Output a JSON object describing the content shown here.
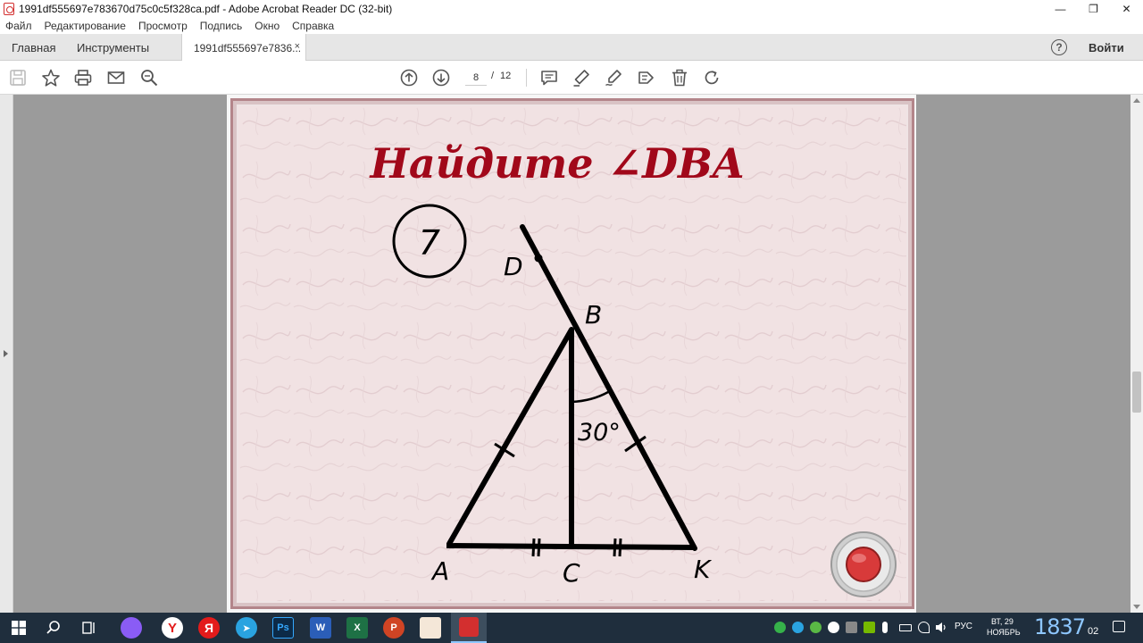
{
  "window": {
    "title": "1991df555697e783670d75c0c5f328ca.pdf - Adobe Acrobat Reader DC (32-bit)",
    "minimize": "—",
    "maximize": "❐",
    "close": "✕"
  },
  "menu": [
    "Файл",
    "Редактирование",
    "Просмотр",
    "Подпись",
    "Окно",
    "Справка"
  ],
  "tabs": {
    "home": "Главная",
    "tools": "Инструменты",
    "document": "1991df555697e7836...",
    "close": "×",
    "help": "?",
    "signin": "Войти"
  },
  "toolbar": {
    "current_page": "8",
    "separator": "/",
    "total_pages": "12"
  },
  "slide": {
    "title": "Найдите  ∠DBA",
    "problem_number": "7",
    "angle_label": "30°",
    "points": {
      "D": "D",
      "B": "B",
      "A": "A",
      "C": "C",
      "K": "K"
    }
  },
  "taskbar": {
    "tray_lang": "РУС",
    "date_day": "ВТ, 29",
    "date_month": "НОЯБРЬ",
    "clock": "1837",
    "clock_seconds": "02"
  },
  "colors": {
    "title_red": "#a1081a",
    "frame": "#b3858a",
    "slide_bg": "#f1e2e3",
    "taskbar": "#1f2e3d",
    "record_button": "#d83a3a"
  }
}
